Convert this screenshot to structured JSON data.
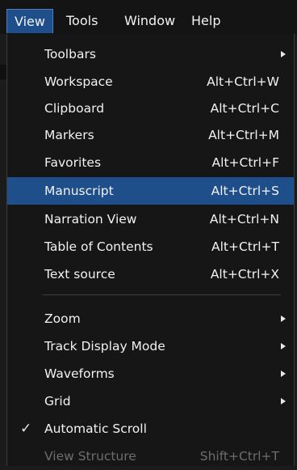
{
  "menubar": {
    "items": [
      {
        "label": "View",
        "active": true
      },
      {
        "label": "Tools",
        "active": false
      },
      {
        "label": "Window",
        "active": false
      },
      {
        "label": "Help",
        "active": false
      }
    ]
  },
  "menu": {
    "items": [
      {
        "label": "Toolbars",
        "shortcut": "",
        "submenu": true
      },
      {
        "label": "Workspace",
        "shortcut": "Alt+Ctrl+W"
      },
      {
        "label": "Clipboard",
        "shortcut": "Alt+Ctrl+C"
      },
      {
        "label": "Markers",
        "shortcut": "Alt+Ctrl+M"
      },
      {
        "label": "Favorites",
        "shortcut": "Alt+Ctrl+F"
      },
      {
        "label": "Manuscript",
        "shortcut": "Alt+Ctrl+S",
        "highlighted": true
      },
      {
        "label": "Narration View",
        "shortcut": "Alt+Ctrl+N"
      },
      {
        "label": "Table of Contents",
        "shortcut": "Alt+Ctrl+T"
      },
      {
        "label": "Text source",
        "shortcut": "Alt+Ctrl+X"
      },
      {
        "label": "Zoom",
        "shortcut": "",
        "submenu": true
      },
      {
        "label": "Track Display Mode",
        "shortcut": "",
        "submenu": true
      },
      {
        "label": "Waveforms",
        "shortcut": "",
        "submenu": true
      },
      {
        "label": "Grid",
        "shortcut": "",
        "submenu": true
      },
      {
        "label": "Automatic Scroll",
        "shortcut": "",
        "checked": true
      },
      {
        "label": "View Structure",
        "shortcut": "Shift+Ctrl+T",
        "disabled": true
      }
    ],
    "check_glyph": "✓"
  },
  "colors": {
    "highlight": "#1f4f8b",
    "background": "#161616",
    "text": "#f2f2f2",
    "disabled_text": "#6d6d6d"
  },
  "icons": {
    "submenu": "chevron-right-icon",
    "check": "check-icon"
  }
}
